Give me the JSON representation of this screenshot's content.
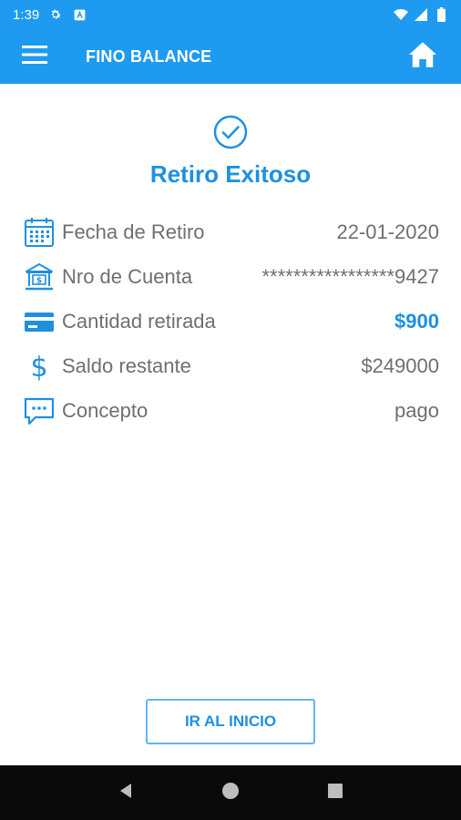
{
  "status_bar": {
    "time": "1:39",
    "icons": [
      "gear-icon",
      "a-notification-icon",
      "wifi-icon",
      "signal-icon",
      "battery-icon"
    ]
  },
  "app_bar": {
    "title": "FINO BALANCE",
    "menu_icon": "hamburger-menu-icon",
    "home_icon": "home-icon"
  },
  "success": {
    "icon": "check-circle-icon",
    "title": "Retiro Exitoso"
  },
  "details": [
    {
      "icon": "calendar-icon",
      "label": "Fecha de Retiro",
      "value": "22-01-2020"
    },
    {
      "icon": "bank-icon",
      "label": "Nro de Cuenta",
      "value": "*****************9427"
    },
    {
      "icon": "credit-card-icon",
      "label": "Cantidad retirada",
      "value": "$900"
    },
    {
      "icon": "dollar-icon",
      "label": "Saldo restante",
      "value": "$249000"
    },
    {
      "icon": "chat-bubble-icon",
      "label": "Concepto",
      "value": "pago"
    }
  ],
  "actions": {
    "home_button": "IR AL INICIO"
  },
  "colors": {
    "primary": "#1e9bf0",
    "accent_text": "#1e90e0",
    "label_text": "#6f6f6f",
    "nav_bar": "#0a0a0a"
  },
  "nav_bar": {
    "buttons": [
      "back-icon",
      "home-circle-icon",
      "recents-square-icon"
    ]
  }
}
